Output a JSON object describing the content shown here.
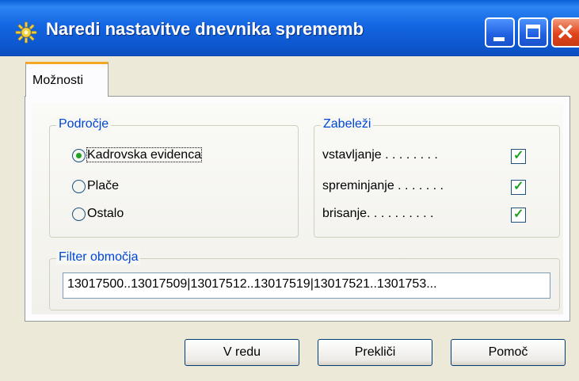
{
  "window": {
    "title": "Naredi nastavitve dnevnika sprememb",
    "controls": {
      "minimize": "minimize-icon",
      "maximize": "maximize-icon",
      "close": "close-icon"
    }
  },
  "tabs": [
    {
      "label": "Možnosti",
      "active": true
    }
  ],
  "podrocje": {
    "legend": "Področje",
    "options": [
      {
        "label": "Kadrovska evidenca",
        "checked": true
      },
      {
        "label": "Plače",
        "checked": false
      },
      {
        "label": "Ostalo",
        "checked": false
      }
    ]
  },
  "zabelezi": {
    "legend": "Zabeleži",
    "items": [
      {
        "label": "vstavljanje . . . . . . . .",
        "checked": true
      },
      {
        "label": "spreminjanje . . . . . . .",
        "checked": true
      },
      {
        "label": "brisanje. . . . . . . . . .",
        "checked": true
      }
    ]
  },
  "filter": {
    "legend": "Filter območja",
    "value": "13017500..13017509|13017512..13017519|13017521..1301753..."
  },
  "buttons": {
    "ok": "V redu",
    "cancel": "Prekliči",
    "help": "Pomoč"
  },
  "colors": {
    "title_bar": "#1466e2",
    "group_legend": "#0046d5",
    "check_mark": "#21a121"
  }
}
